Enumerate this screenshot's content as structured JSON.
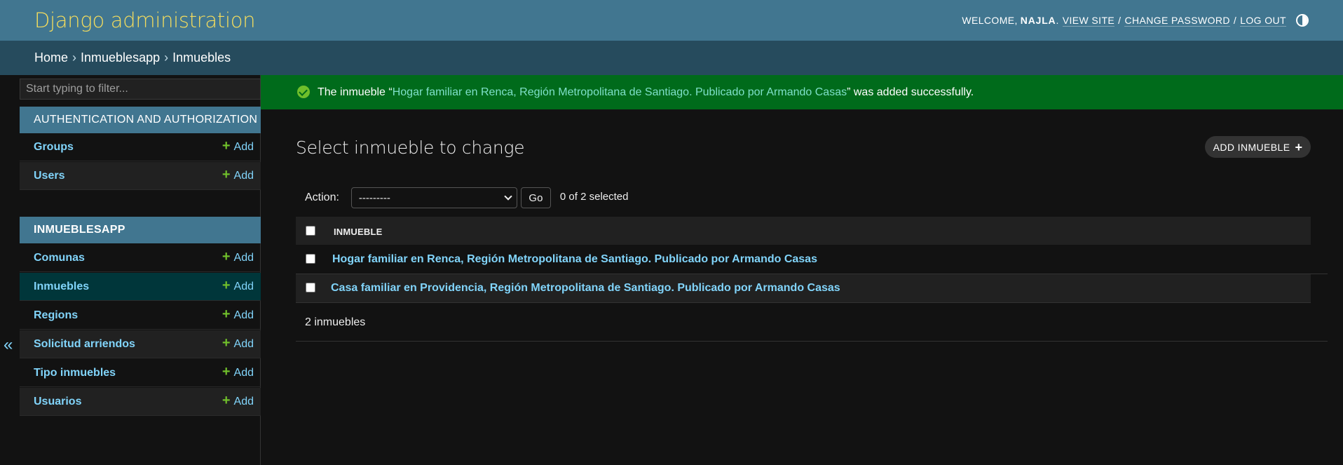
{
  "header": {
    "branding": "Django administration",
    "welcome": "WELCOME,",
    "username": "NAJLA",
    "view_site": "VIEW SITE",
    "change_password": "CHANGE PASSWORD",
    "log_out": "LOG OUT",
    "separator": "/",
    "period": ".",
    "theme_icon": "contrast-icon"
  },
  "breadcrumbs": {
    "home": "Home",
    "app": "Inmueblesapp",
    "current": "Inmuebles",
    "separator": "›"
  },
  "sidebar": {
    "filter_placeholder": "Start typing to filter...",
    "modules": [
      {
        "caption": "AUTHENTICATION AND AUTHORIZATION",
        "models": [
          {
            "name": "Groups",
            "add": "Add"
          },
          {
            "name": "Users",
            "add": "Add"
          }
        ]
      },
      {
        "caption": "INMUEBLESAPP",
        "models": [
          {
            "name": "Comunas",
            "add": "Add"
          },
          {
            "name": "Inmuebles",
            "add": "Add"
          },
          {
            "name": "Regions",
            "add": "Add"
          },
          {
            "name": "Solicitud arriendos",
            "add": "Add"
          },
          {
            "name": "Tipo inmuebles",
            "add": "Add"
          },
          {
            "name": "Usuarios",
            "add": "Add"
          }
        ]
      }
    ],
    "toggle_label": "«"
  },
  "message": {
    "prefix": "The inmueble “",
    "object_link": "Hogar familiar en Renca, Región Metropolitana de Santiago. Publicado por Armando Casas",
    "suffix": "” was added successfully."
  },
  "content": {
    "title": "Select inmueble to change",
    "add_button": "ADD INMUEBLE",
    "action_label": "Action:",
    "action_selected": "---------",
    "go_button": "Go",
    "selected_count": "0 of 2 selected",
    "column_header": "INMUEBLE",
    "rows": [
      "Hogar familiar en Renca, Región Metropolitana de Santiago. Publicado por Armando Casas",
      "Casa familiar en Providencia, Región Metropolitana de Santiago. Publicado por Armando Casas"
    ],
    "result_count": "2 inmuebles"
  },
  "colors": {
    "header": "#417690",
    "breadcrumbs": "#264b5d",
    "branding": "#f5dd5d",
    "link": "#81d4fa",
    "add_plus": "#70bf2b",
    "success_bg": "#006b1b",
    "background": "#121212"
  }
}
